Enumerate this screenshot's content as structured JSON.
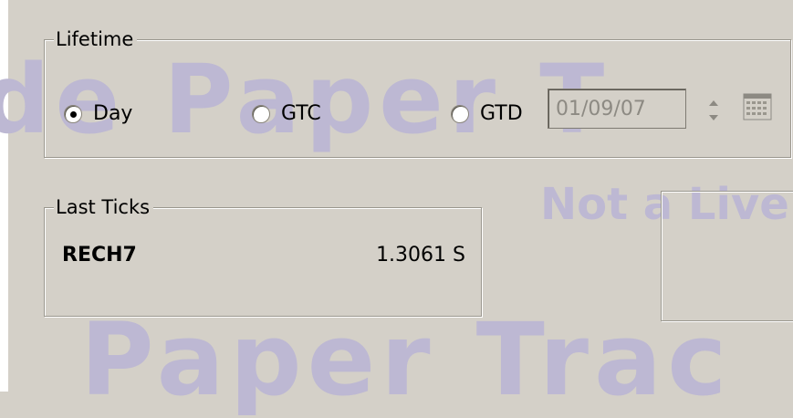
{
  "watermark": {
    "line1": "de Paper T",
    "line2": "Not a Live",
    "line3": "Paper Trac"
  },
  "lifetime": {
    "legend": "Lifetime",
    "options": [
      {
        "label": "Day",
        "checked": true
      },
      {
        "label": "GTC",
        "checked": false
      },
      {
        "label": "GTD",
        "checked": false
      }
    ],
    "gtd_date": "01/09/07",
    "date_field_disabled": true
  },
  "last_ticks": {
    "legend": "Last Ticks",
    "symbol": "RECH7",
    "price": "1.3061 S"
  },
  "icons": [
    "spinner-icon",
    "calendar-icon"
  ],
  "colors": {
    "background": "#d4d0c8",
    "watermark": "#bdb8d3",
    "disabled_text": "#8d8a83"
  }
}
